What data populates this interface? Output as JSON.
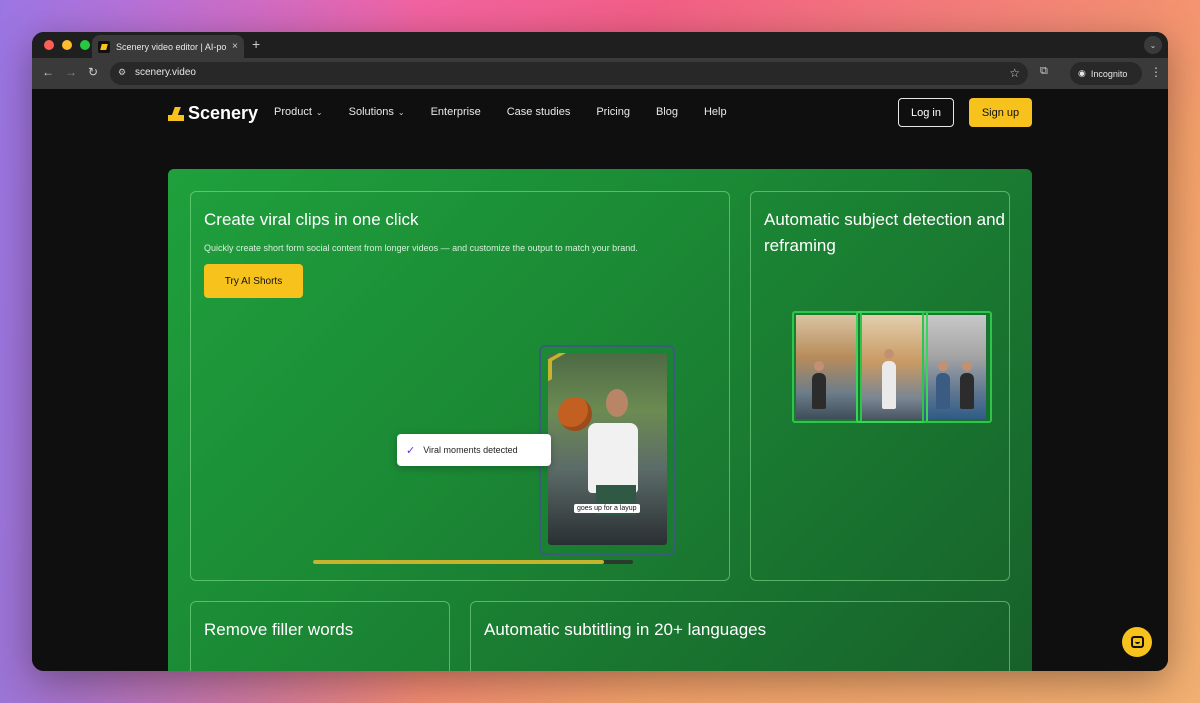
{
  "browser": {
    "tab_title": "Scenery video editor | AI-pow",
    "tab_close": "×",
    "new_tab": "+",
    "address": "scenery.video",
    "incognito_label": "Incognito"
  },
  "site": {
    "logo_text": "Scenery",
    "nav": [
      {
        "label": "Product",
        "chevron": true
      },
      {
        "label": "Solutions",
        "chevron": true
      },
      {
        "label": "Enterprise",
        "chevron": false
      },
      {
        "label": "Case studies",
        "chevron": false
      },
      {
        "label": "Pricing",
        "chevron": false
      },
      {
        "label": "Blog",
        "chevron": false
      },
      {
        "label": "Help",
        "chevron": false
      }
    ],
    "login_label": "Log in",
    "signup_label": "Sign up"
  },
  "features": {
    "clips": {
      "title": "Create viral clips in one click",
      "subtitle": "Quickly create short form social content from longer videos — and customize the output to match your brand.",
      "cta": "Try AI Shorts",
      "toast": "Viral moments detected",
      "caption": "goes up for a layup",
      "progress": 0.91
    },
    "reframe": {
      "title": "Automatic subject detection and reframing"
    },
    "filler": {
      "title": "Remove filler words"
    },
    "subtitles": {
      "title": "Automatic subtitling in 20+ languages"
    }
  },
  "colors": {
    "accent": "#f7c21b",
    "hero_green": "#1fa03d",
    "check_purple": "#6b2ecf"
  }
}
